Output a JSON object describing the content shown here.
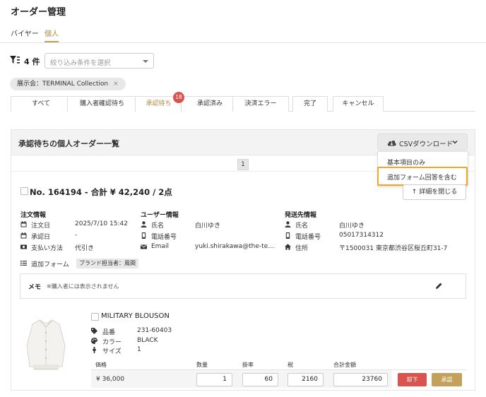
{
  "page": {
    "title": "オーダー管理"
  },
  "nav": {
    "items": [
      "バイヤー",
      "個人"
    ]
  },
  "filter": {
    "count": "4 件",
    "placeholder": "絞り込み条件を選択"
  },
  "chip": {
    "label": "展示会：TERMINAL Collection",
    "close": "×"
  },
  "tabs": [
    {
      "label": "すべて"
    },
    {
      "label": "購入者確認待ち"
    },
    {
      "label": "承認待ち",
      "badge": "18"
    },
    {
      "label": "承認済み"
    },
    {
      "label": "決済エラー"
    },
    {
      "label": "完了"
    },
    {
      "label": "キャンセル"
    }
  ],
  "panel": {
    "title": "承認待ちの個人オーダー一覧"
  },
  "csv": {
    "button_label": "CSVダウンロード",
    "options": [
      "基本項目のみ",
      "追加フォーム回答を含む"
    ]
  },
  "pager": {
    "current": "1"
  },
  "order": {
    "title": "No. 164194 - 合計 ¥ 42,240 / 2点",
    "detail_button": "↑ 詳細を閉じる",
    "info": {
      "heading": "注文情報",
      "rows": [
        {
          "label": "注文日",
          "value": "2025/7/10 15:42"
        },
        {
          "label": "承認日",
          "value": "-"
        },
        {
          "label": "支払い方法",
          "value": "代引き"
        }
      ]
    },
    "user": {
      "heading": "ユーザー情報",
      "rows": [
        {
          "label": "氏名",
          "value": "白川ゆき"
        },
        {
          "label": "電話番号",
          "value": ""
        },
        {
          "label": "Email",
          "value": "yuki.shirakawa@the-te…"
        }
      ]
    },
    "shipping": {
      "heading": "発送先情報",
      "rows": [
        {
          "label": "氏名",
          "value": "白川ゆき"
        },
        {
          "label": "電話番号",
          "value": "05017314312"
        },
        {
          "label": "住所",
          "value": "〒1500031 東京都渋谷区桜丘町31-7"
        }
      ]
    },
    "extra_form": {
      "label": "追加フォーム",
      "tag": "ブランド担当者：風間"
    },
    "memo": {
      "title": "メモ",
      "note": "※購入者には表示されません"
    }
  },
  "product": {
    "name": "MILITARY BLOUSON",
    "specs": [
      {
        "label": "品番",
        "value": "231-60403"
      },
      {
        "label": "カラー",
        "value": "BLACK"
      },
      {
        "label": "サイズ",
        "value": "1"
      }
    ],
    "table": {
      "headers": [
        "価格",
        "数量",
        "掛率",
        "税",
        "合計金額"
      ],
      "price": "¥ 36,000",
      "quantity": "1",
      "rate": "60",
      "tax": "2160",
      "total": "23760"
    },
    "reject_label": "却下",
    "approve_label": "承認"
  },
  "colors": {
    "accent": "#c4a15a",
    "danger": "#d9534f",
    "highlight": "#f5a623"
  }
}
